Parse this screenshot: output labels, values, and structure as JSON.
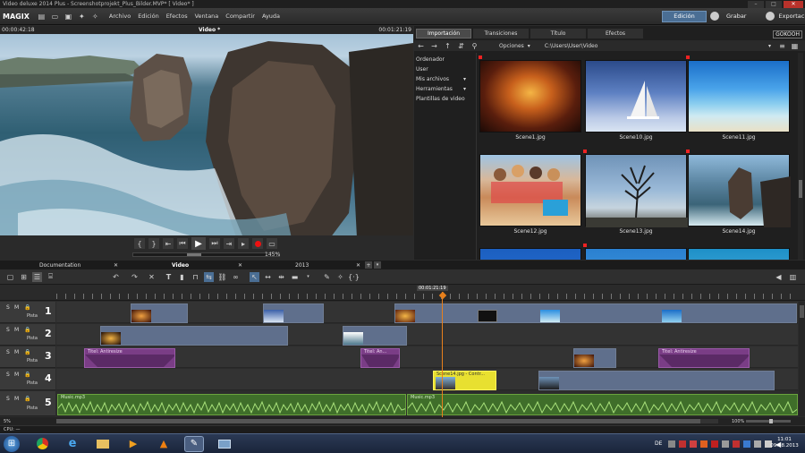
{
  "window": {
    "title": "Video deluxe 2014 Plus - Screenshotprojekt_Plus_Bilder.MVP* [ Video* ]"
  },
  "menu": {
    "logo": "MAGIX",
    "items": [
      "Archivo",
      "Edición",
      "Efectos",
      "Ventana",
      "Compartir",
      "Ayuda"
    ]
  },
  "modes": {
    "edit": "Edición",
    "record": "Grabar",
    "export": "Exportación"
  },
  "monitor": {
    "time_left": "00:00:42:18",
    "title": "Video *",
    "time_right": "00:01:21:19",
    "zoom": "145%"
  },
  "media_pool": {
    "tabs": [
      "Importación",
      "Transiciones",
      "Título",
      "Efectos"
    ],
    "active_tab": "Importación",
    "brand": "GOKOOH",
    "options_label": "Opciones",
    "path": "C:\\Users\\User\\Video",
    "tree": [
      "Ordenador",
      "User",
      "Mis archivos",
      "Herramientas",
      "Plantillas de video"
    ],
    "files": [
      {
        "name": "Scene1.jpg",
        "marked": true,
        "colors": [
          "#c8601c",
          "#1c0a06"
        ]
      },
      {
        "name": "Scene10.jpg",
        "marked": false,
        "colors": [
          "#3a5fa8",
          "#b9c9e6"
        ]
      },
      {
        "name": "Scene11.jpg",
        "marked": true,
        "colors": [
          "#2a8ee0",
          "#bfe6f4"
        ]
      },
      {
        "name": "Scene12.jpg",
        "marked": false,
        "colors": [
          "#d9a87a",
          "#6d9ac8"
        ]
      },
      {
        "name": "Scene13.jpg",
        "marked": true,
        "colors": [
          "#9bbad8",
          "#3a4a5c"
        ]
      },
      {
        "name": "Scene14.jpg",
        "marked": true,
        "colors": [
          "#7fb0d8",
          "#3a3430"
        ]
      }
    ]
  },
  "tabs_bottom": {
    "left": "Documentation",
    "center": "Video",
    "right": "2013"
  },
  "timeline": {
    "playhead_time": "00:01:21:19",
    "tracks": [
      {
        "number": "1",
        "label": "Pista"
      },
      {
        "number": "2",
        "label": "Pista"
      },
      {
        "number": "3",
        "label": "Pista"
      },
      {
        "number": "4",
        "label": "Pista"
      },
      {
        "number": "5",
        "label": "Pista"
      }
    ],
    "clip_labels": {
      "t3_title1": "Titel: Antiresize",
      "t3_title2": "Titel: An...",
      "t3_title3": "Titel: Antiresize",
      "t4_yellow": "Scene14.jpg - Contr...",
      "t5_music1": "Music.mp3",
      "t5_music2": "Music.mp3"
    },
    "zoom_left": "5%",
    "zoom_right": "100%"
  },
  "statusbar": {
    "cpu": "CPU: —"
  },
  "taskbar": {
    "lang": "DE",
    "time": "11:01",
    "date": "09.08.2013"
  }
}
